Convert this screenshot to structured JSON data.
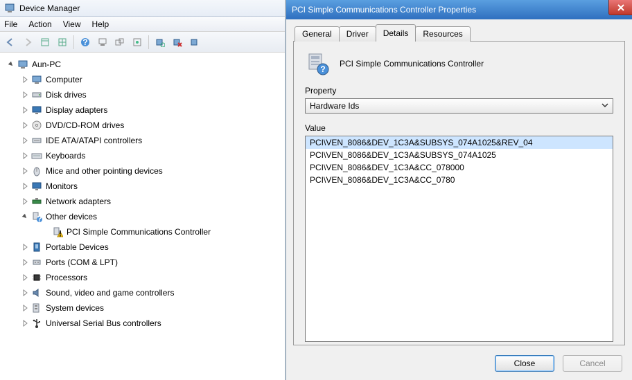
{
  "devmgr": {
    "title": "Device Manager",
    "menus": [
      "File",
      "Action",
      "View",
      "Help"
    ],
    "root_label": "Aun-PC",
    "categories": [
      {
        "label": "Computer",
        "icon": "computer"
      },
      {
        "label": "Disk drives",
        "icon": "disk"
      },
      {
        "label": "Display adapters",
        "icon": "display"
      },
      {
        "label": "DVD/CD-ROM drives",
        "icon": "disc"
      },
      {
        "label": "IDE ATA/ATAPI controllers",
        "icon": "ide"
      },
      {
        "label": "Keyboards",
        "icon": "keyboard"
      },
      {
        "label": "Mice and other pointing devices",
        "icon": "mouse"
      },
      {
        "label": "Monitors",
        "icon": "monitor"
      },
      {
        "label": "Network adapters",
        "icon": "network"
      },
      {
        "label": "Other devices",
        "icon": "other",
        "expanded": true,
        "children": [
          {
            "label": "PCI Simple Communications Controller",
            "icon": "warn-device"
          }
        ]
      },
      {
        "label": "Portable Devices",
        "icon": "portable"
      },
      {
        "label": "Ports (COM & LPT)",
        "icon": "ports"
      },
      {
        "label": "Processors",
        "icon": "cpu"
      },
      {
        "label": "Sound, video and game controllers",
        "icon": "sound"
      },
      {
        "label": "System devices",
        "icon": "system"
      },
      {
        "label": "Universal Serial Bus controllers",
        "icon": "usb"
      }
    ]
  },
  "dialog": {
    "title": "PCI Simple Communications Controller Properties",
    "tabs": [
      "General",
      "Driver",
      "Details",
      "Resources"
    ],
    "active_tab": "Details",
    "device_name": "PCI Simple Communications Controller",
    "property_label": "Property",
    "property_selected": "Hardware Ids",
    "value_label": "Value",
    "values": [
      "PCI\\VEN_8086&DEV_1C3A&SUBSYS_074A1025&REV_04",
      "PCI\\VEN_8086&DEV_1C3A&SUBSYS_074A1025",
      "PCI\\VEN_8086&DEV_1C3A&CC_078000",
      "PCI\\VEN_8086&DEV_1C3A&CC_0780"
    ],
    "selected_value_index": 0,
    "close_label": "Close",
    "cancel_label": "Cancel"
  }
}
